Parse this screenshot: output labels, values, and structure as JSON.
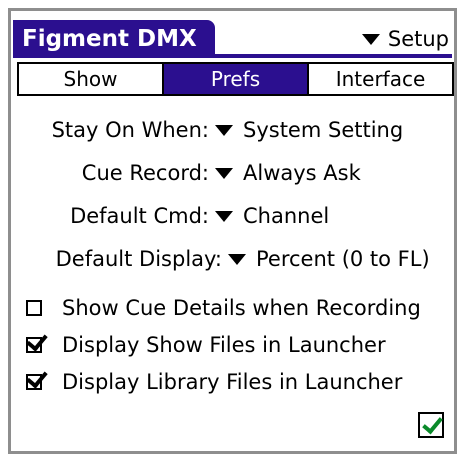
{
  "app": {
    "title": "Figment DMX",
    "menu_label": "Setup",
    "accent_color": "#2b0f8f",
    "confirm_color": "#0a8a2a"
  },
  "tabs": [
    {
      "label": "Show",
      "active": false
    },
    {
      "label": "Prefs",
      "active": true
    },
    {
      "label": "Interface",
      "active": false
    }
  ],
  "prefs": {
    "stay_on": {
      "label": "Stay On When:",
      "value": "System Setting"
    },
    "cue_record": {
      "label": "Cue Record:",
      "value": "Always Ask"
    },
    "default_cmd": {
      "label": "Default Cmd:",
      "value": "Channel"
    },
    "default_display": {
      "label": "Default Display:",
      "value": "Percent (0 to FL)"
    }
  },
  "options": [
    {
      "label": "Show Cue Details when Recording",
      "checked": false
    },
    {
      "label": "Display Show Files in Launcher",
      "checked": true
    },
    {
      "label": "Display Library Files in Launcher",
      "checked": true
    }
  ],
  "confirm_icon": "green-checkmark-icon"
}
